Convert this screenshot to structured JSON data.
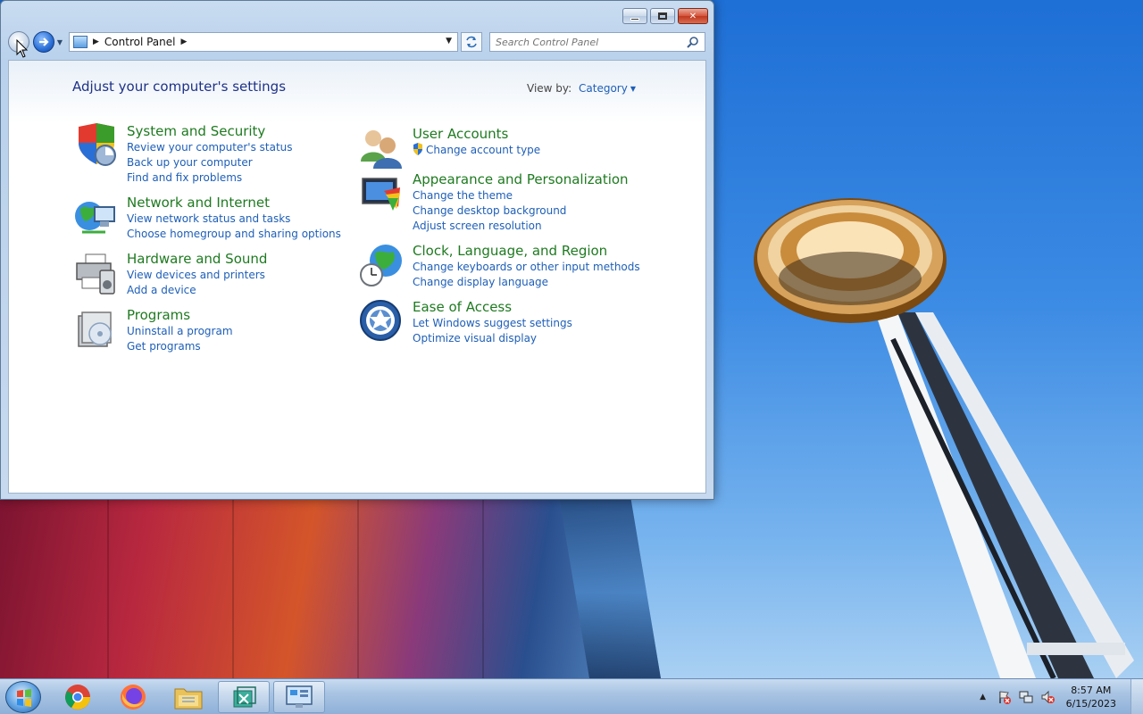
{
  "window": {
    "title": "Control Panel",
    "caption": {
      "minimize": "",
      "maximize": "",
      "close": "✕"
    }
  },
  "navbar": {
    "breadcrumb": "Control Panel",
    "search_placeholder": "Search Control Panel"
  },
  "content": {
    "title": "Adjust your computer's settings",
    "view_by_label": "View by:",
    "view_by_value": "Category",
    "categories_left": [
      {
        "heading": "System and Security",
        "links": [
          "Review your computer's status",
          "Back up your computer",
          "Find and fix problems"
        ]
      },
      {
        "heading": "Network and Internet",
        "links": [
          "View network status and tasks",
          "Choose homegroup and sharing options"
        ]
      },
      {
        "heading": "Hardware and Sound",
        "links": [
          "View devices and printers",
          "Add a device"
        ]
      },
      {
        "heading": "Programs",
        "links": [
          "Uninstall a program",
          "Get programs"
        ]
      }
    ],
    "categories_right": [
      {
        "heading": "User Accounts",
        "links": [
          "Change account type"
        ]
      },
      {
        "heading": "Appearance and Personalization",
        "links": [
          "Change the theme",
          "Change desktop background",
          "Adjust screen resolution"
        ]
      },
      {
        "heading": "Clock, Language, and Region",
        "links": [
          "Change keyboards or other input methods",
          "Change display language"
        ]
      },
      {
        "heading": "Ease of Access",
        "links": [
          "Let Windows suggest settings",
          "Optimize visual display"
        ]
      }
    ]
  },
  "taskbar": {
    "apps": [
      "start",
      "chrome",
      "firefox",
      "file-explorer",
      "program",
      "control-panel"
    ],
    "time": "8:57 AM",
    "date": "6/15/2023"
  },
  "colors": {
    "heading_green": "#1e7a20",
    "link_blue": "#1e5fb8",
    "title_blue": "#1e3287"
  }
}
